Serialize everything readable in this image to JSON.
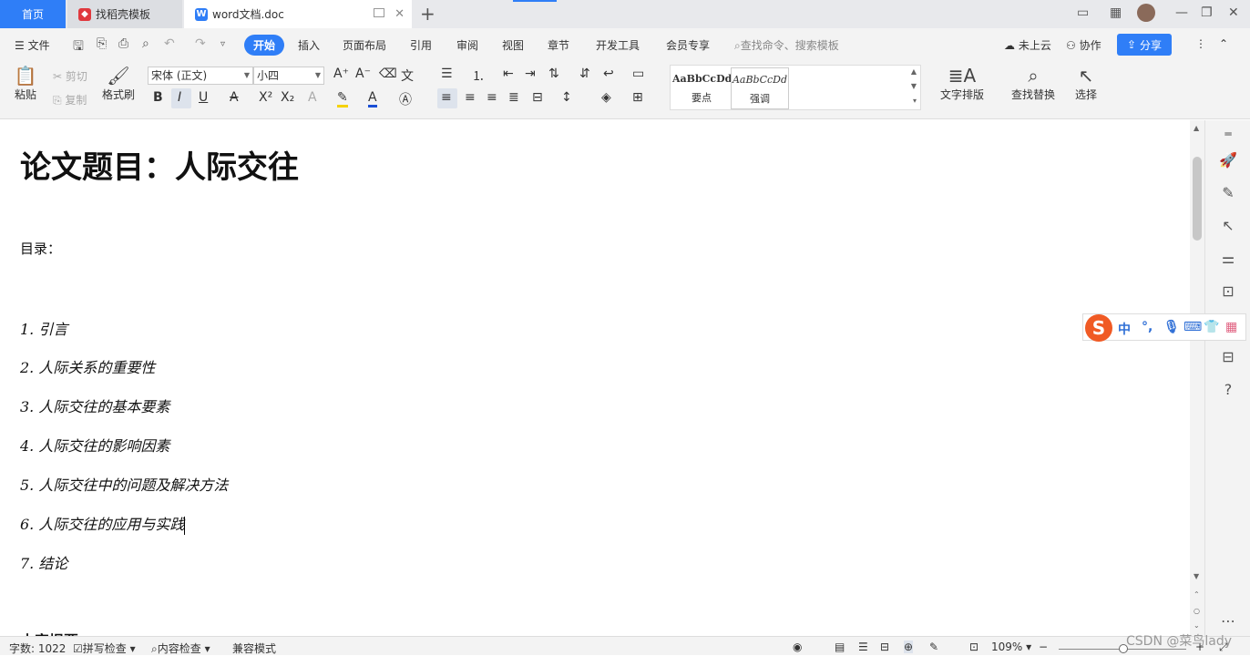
{
  "tabs": {
    "home": "首页",
    "template": "找稻壳模板",
    "document": "word文档.doc",
    "add": "+"
  },
  "window_controls": {
    "minimize": "—",
    "restore": "❐",
    "close": "✕"
  },
  "menu": {
    "file": "文件",
    "items": [
      "开始",
      "插入",
      "页面布局",
      "引用",
      "审阅",
      "视图",
      "章节",
      "开发工具",
      "会员专享"
    ],
    "search_placeholder": "查找命令、搜索模板",
    "cloud": "未上云",
    "collab": "协作",
    "share": "分享"
  },
  "ribbon": {
    "paste": "粘贴",
    "cut": "剪切",
    "copy": "复制",
    "format_painter": "格式刷",
    "font_name": "宋体 (正文)",
    "font_size": "小四",
    "bold": "B",
    "italic": "I",
    "underline": "U",
    "styles": [
      {
        "sample": "AaBbCcDd",
        "name": "要点"
      },
      {
        "sample": "AaBbCcDd",
        "name": "强调"
      }
    ],
    "text_layout": "文字排版",
    "find_replace": "查找替换",
    "select": "选择"
  },
  "document": {
    "title": "论文题目：人际交往",
    "toc_label": "目录：",
    "toc": [
      "1. 引言",
      "2. 人际关系的重要性",
      "3. 人际交往的基本要素",
      "4. 人际交往的影响因素",
      "5. 人际交往中的问题及解决方法",
      "6. 人际交往的应用与实践",
      "7. 结论"
    ],
    "next_heading": "内容提要"
  },
  "ime": {
    "mode": "中",
    "punct": "°,",
    "logo": "S"
  },
  "status": {
    "word_count": "字数: 1022",
    "spell_check": "拼写检查",
    "content_check": "内容检查",
    "compat_mode": "兼容模式",
    "zoom": "109%",
    "zoom_level_percent": 109
  },
  "watermark": "CSDN @菜鸟lady",
  "colors": {
    "accent": "#2f7ef7",
    "ime": "#f05a24"
  },
  "icons": [
    "wps-doc-icon",
    "template-icon",
    "undo-icon",
    "redo-icon",
    "print-icon",
    "search-icon",
    "cloud-icon",
    "share-icon",
    "paste-icon",
    "brush-icon",
    "find-icon",
    "select-cursor-icon",
    "rocket-icon",
    "pen-icon",
    "cursor-icon",
    "sliders-icon",
    "help-icon"
  ]
}
